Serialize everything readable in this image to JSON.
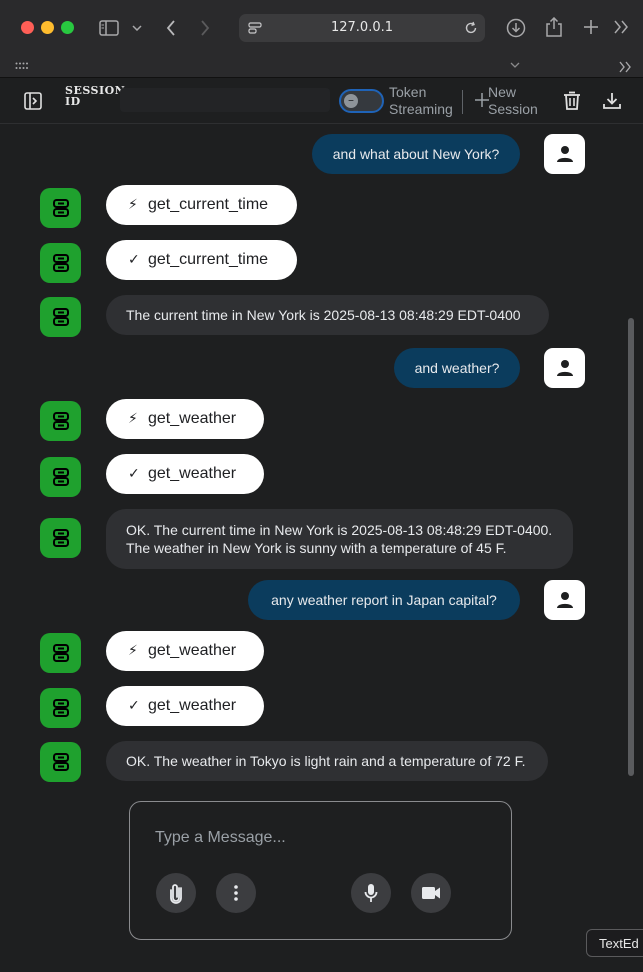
{
  "browser": {
    "url": "127.0.0.1"
  },
  "toolbar": {
    "session_label_line1": "SESSION",
    "session_label_line2": "ID",
    "token_streaming_line1": "Token",
    "token_streaming_line2": "Streaming",
    "token_streaming_enabled": false,
    "new_session_line1": "New",
    "new_session_line2": "Session"
  },
  "messages": [
    {
      "role": "user",
      "text": "and what about New York?"
    },
    {
      "role": "tool_call",
      "text": "get_current_time"
    },
    {
      "role": "tool_result",
      "text": "get_current_time"
    },
    {
      "role": "bot",
      "text": "The current time in New York is 2025-08-13 08:48:29 EDT-0400"
    },
    {
      "role": "user",
      "text": "and weather?"
    },
    {
      "role": "tool_call",
      "text": "get_weather"
    },
    {
      "role": "tool_result",
      "text": "get_weather"
    },
    {
      "role": "bot",
      "text": "OK. The current time in New York is 2025-08-13 08:48:29 EDT-0400. The weather in New York is sunny with a temperature of 45 F."
    },
    {
      "role": "user",
      "text": "any weather report in Japan capital?"
    },
    {
      "role": "tool_call",
      "text": "get_weather"
    },
    {
      "role": "tool_result",
      "text": "get_weather"
    },
    {
      "role": "bot",
      "text": "OK. The weather in Tokyo is light rain and a temperature of 72 F."
    }
  ],
  "composer": {
    "placeholder": "Type a Message..."
  },
  "tooltip": {
    "text": "TextEd"
  },
  "colors": {
    "bot_avatar": "#1fa12e",
    "user_bubble": "#0b3c5d",
    "bot_bubble": "#2f3033",
    "tool_bubble": "#ffffff",
    "toggle_border": "#1f63b7"
  },
  "icons": {
    "sidebar": "sidebar-icon",
    "tool_call": "bolt-icon",
    "tool_result": "check-icon",
    "bot": "robot-icon",
    "user": "person-icon",
    "attach": "paperclip-icon",
    "more": "more-vert-icon",
    "mic": "microphone-icon",
    "camera": "video-camera-icon",
    "delete": "trash-icon",
    "download": "download-icon"
  }
}
